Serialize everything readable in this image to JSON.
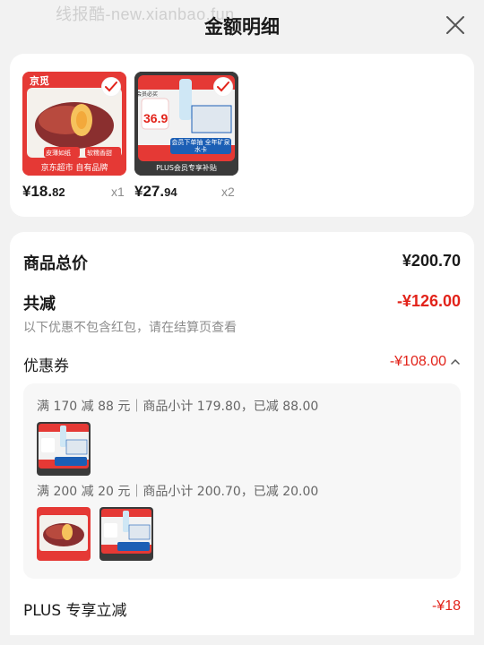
{
  "watermark": "线报酷-new.xianbao.fun",
  "header": {
    "title": "金额明细"
  },
  "products": [
    {
      "image_caption": "京东超市 自有品牌",
      "image_brand": "京觅",
      "tag_left": "皮薄如纸",
      "tag_right": "软糯香甜",
      "price_main": "¥18.",
      "price_cents": "82",
      "qty": "x1"
    },
    {
      "image_caption": "PLUS会员专享补贴",
      "image_top": "会员必买",
      "image_price": "36.9",
      "image_banner": "会员下单抽 全年矿泉水卡",
      "price_main": "¥27.",
      "price_cents": "94",
      "qty": "x2"
    }
  ],
  "summary": {
    "total_label": "商品总价",
    "total_value": "¥200.70",
    "reduce_label": "共减",
    "reduce_value": "-¥126.00",
    "reduce_note": "以下优惠不包含红包，请在结算页查看",
    "coupon_label": "优惠券",
    "coupon_value": "-¥108.00",
    "coupon_lines": [
      "满 170 减 88 元｜商品小计 179.80，已减 88.00",
      "满 200 减 20 元｜商品小计 200.70，已减 20.00"
    ],
    "plus_label": "PLUS 专享立减",
    "plus_value": "-¥18"
  },
  "colors": {
    "accent": "#e2231a",
    "background": "#f2f2f2"
  },
  "icons": {
    "close": "close-icon",
    "check": "check-icon",
    "chevron": "chevron-up-icon"
  }
}
